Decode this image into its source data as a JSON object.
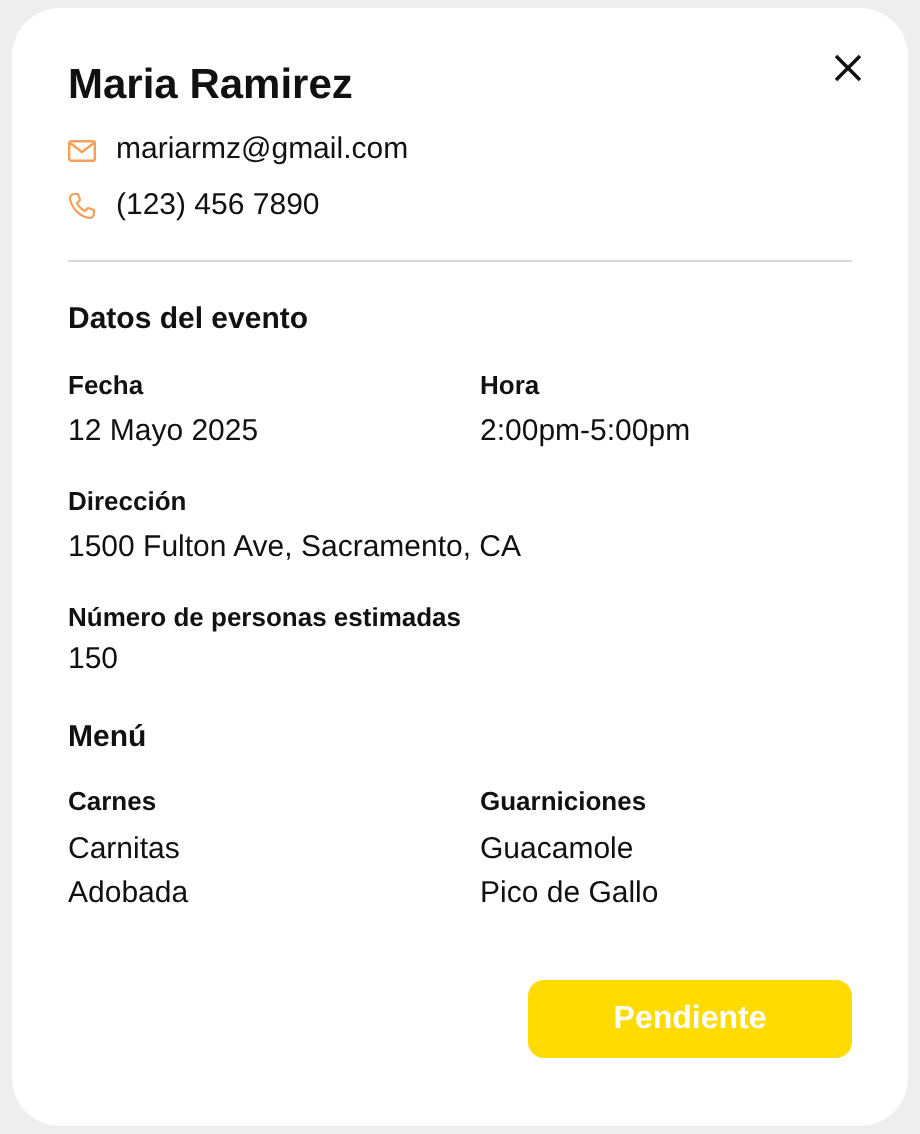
{
  "contact": {
    "name": "Maria Ramirez",
    "email": "mariarmz@gmail.com",
    "phone": "(123) 456 7890"
  },
  "event": {
    "title": "Datos del evento",
    "fields": [
      {
        "label": "Fecha",
        "value": "12 Mayo 2025"
      },
      {
        "label": "Hora",
        "value": "2:00pm-5:00pm"
      },
      {
        "label": "Dirección",
        "value": "1500 Fulton Ave, Sacramento, CA"
      },
      {
        "label": "Número de personas estimadas",
        "value": "150"
      }
    ]
  },
  "menu": {
    "title": "Menú",
    "groups": [
      {
        "label": "Carnes",
        "items": [
          "Carnitas",
          "Adobada"
        ]
      },
      {
        "label": "Guarniciones",
        "items": [
          "Guacamole",
          "Pico de Gallo"
        ]
      }
    ]
  },
  "status": {
    "label": "Pendiente",
    "kind": "pending"
  }
}
